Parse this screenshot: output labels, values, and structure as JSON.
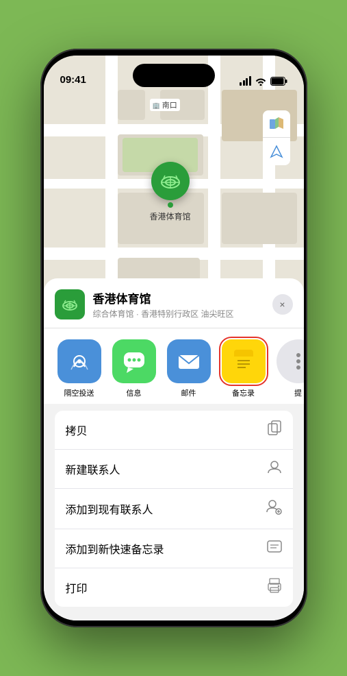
{
  "status_bar": {
    "time": "09:41",
    "battery": "🔋"
  },
  "map": {
    "label_south_entrance": "南口",
    "label_map_type": "🗺",
    "label_location": "➤"
  },
  "venue": {
    "name": "香港体育馆",
    "description": "综合体育馆 · 香港特别行政区 油尖旺区",
    "icon": "🏟",
    "pin_label": "香港体育馆"
  },
  "share_items": [
    {
      "id": "airdrop",
      "label": "隔空投送",
      "icon": "📡",
      "bg": "#4a90d9"
    },
    {
      "id": "messages",
      "label": "信息",
      "icon": "💬",
      "bg": "#4cd964"
    },
    {
      "id": "mail",
      "label": "邮件",
      "icon": "✉️",
      "bg": "#4a90d9"
    },
    {
      "id": "notes",
      "label": "备忘录",
      "icon": "📝",
      "bg": "#ffd60a",
      "selected": true
    },
    {
      "id": "more",
      "label": "提",
      "icon": "···",
      "bg": "#e5e5ea"
    }
  ],
  "actions": [
    {
      "id": "copy",
      "label": "拷贝",
      "icon": "⧉"
    },
    {
      "id": "new-contact",
      "label": "新建联系人",
      "icon": "👤"
    },
    {
      "id": "add-existing",
      "label": "添加到现有联系人",
      "icon": "👤"
    },
    {
      "id": "add-notes",
      "label": "添加到新快速备忘录",
      "icon": "🖼"
    },
    {
      "id": "print",
      "label": "打印",
      "icon": "🖨"
    }
  ],
  "close_btn": "×"
}
